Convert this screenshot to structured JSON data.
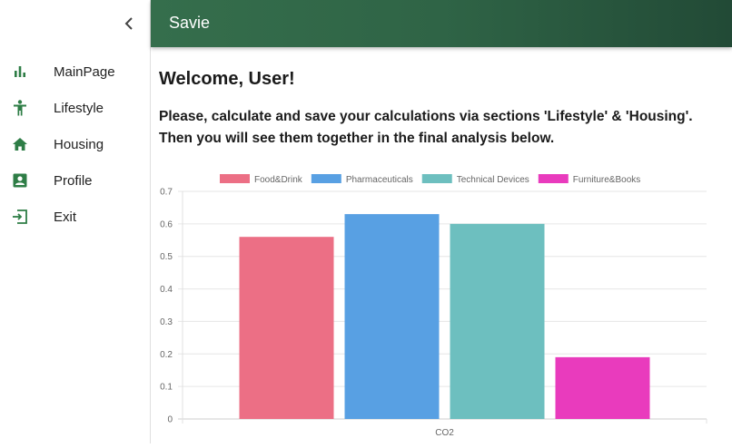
{
  "sidebar": {
    "items": [
      {
        "label": "MainPage",
        "icon": "bar-chart-icon"
      },
      {
        "label": "Lifestyle",
        "icon": "person-icon"
      },
      {
        "label": "Housing",
        "icon": "home-icon"
      },
      {
        "label": "Profile",
        "icon": "profile-icon"
      },
      {
        "label": "Exit",
        "icon": "exit-icon"
      }
    ]
  },
  "appbar": {
    "title": "Savie"
  },
  "main": {
    "welcome": "Welcome, User!",
    "instructions": "Please, calculate and save your calculations via sections 'Lifestyle' & 'Housing'. Then you will see them together in the final analysis below."
  },
  "colors": {
    "accent": "#2e7d46",
    "appbar_start": "#356e4c",
    "appbar_end": "#224a36"
  },
  "chart_data": {
    "type": "bar",
    "categories": [
      "CO2"
    ],
    "series": [
      {
        "name": "Food&Drink",
        "values": [
          0.56
        ],
        "color": "#ec6f85"
      },
      {
        "name": "Pharmaceuticals",
        "values": [
          0.63
        ],
        "color": "#58a0e3"
      },
      {
        "name": "Technical Devices",
        "values": [
          0.6
        ],
        "color": "#6dbfbf"
      },
      {
        "name": "Furniture&Books",
        "values": [
          0.19
        ],
        "color": "#e93bbd"
      }
    ],
    "ylim": [
      0,
      0.7
    ],
    "yticks": [
      "0",
      "0.1",
      "0.2",
      "0.3",
      "0.4",
      "0.5",
      "0.6",
      "0.7"
    ],
    "grid": true,
    "legend": "top"
  }
}
